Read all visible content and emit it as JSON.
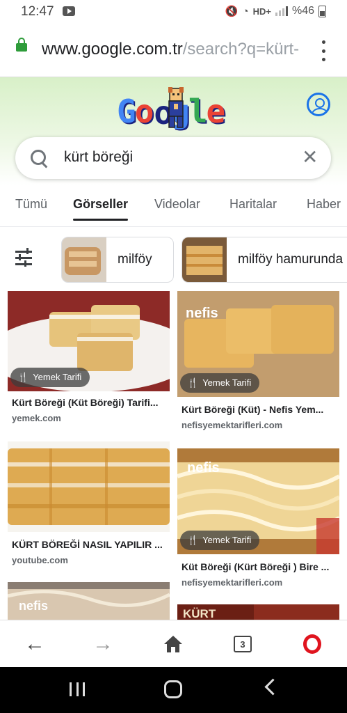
{
  "status_bar": {
    "time": "12:47",
    "network_label": "HD+",
    "battery_text": "%46"
  },
  "url_bar": {
    "host": "www.google.com.tr",
    "path": "/search?q=kürt-"
  },
  "search": {
    "query": "kürt böreği"
  },
  "tabs": [
    {
      "label": "Tümü",
      "active": false
    },
    {
      "label": "Görseller",
      "active": true
    },
    {
      "label": "Videolar",
      "active": false
    },
    {
      "label": "Haritalar",
      "active": false
    },
    {
      "label": "Haber",
      "active": false
    }
  ],
  "chips": [
    {
      "label": "milföy"
    },
    {
      "label": "milföy hamurunda"
    }
  ],
  "results": [
    {
      "badge": "Yemek Tarifi",
      "title": "Kürt Böreği (Küt Böreği) Tarifi...",
      "source": "yemek.com"
    },
    {
      "badge": "Yemek Tarifi",
      "title": "Kürt Böreği (Küt) - Nefis Yem...",
      "source": "nefisyemektarifleri.com"
    },
    {
      "badge": "",
      "title": "KÜRT BÖREĞİ NASIL YAPILIR ...",
      "source": "youtube.com"
    },
    {
      "badge": "Yemek Tarifi",
      "title": "Küt Böreği (Kürt Böreği ) Bire ...",
      "source": "nefisyemektarifleri.com"
    },
    {
      "badge": "",
      "title": "",
      "source": ""
    },
    {
      "badge": "",
      "title": "",
      "source": "",
      "image_text": "KÜRT"
    }
  ],
  "image_watermark": "nefis",
  "toolbar": {
    "tab_count": "3"
  },
  "icons": {
    "search": "search-icon",
    "clear": "close-icon",
    "account": "account-icon",
    "filter": "tune-icon",
    "recipe": "fork-knife-icon"
  },
  "colors": {
    "accent_blue": "#1a73e8",
    "lock_green": "#2e9c3a",
    "opera_red": "#e0141e"
  }
}
